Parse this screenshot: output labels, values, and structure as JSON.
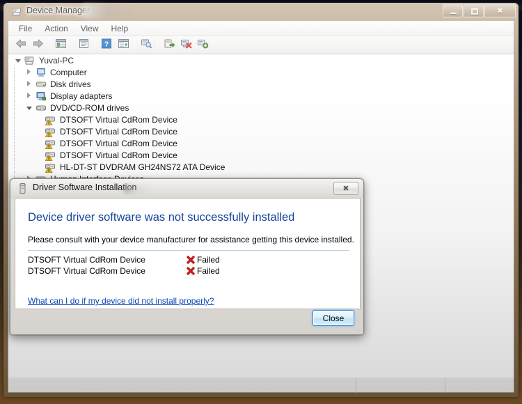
{
  "window": {
    "title": "Device Manager",
    "title_icon": "device-manager-icon",
    "controls": {
      "minimize": "Minimize",
      "maximize": "Maximize",
      "close": "Close"
    }
  },
  "menubar": {
    "items": [
      {
        "label": "File"
      },
      {
        "label": "Action"
      },
      {
        "label": "View"
      },
      {
        "label": "Help"
      }
    ]
  },
  "toolbar": {
    "buttons": [
      {
        "name": "back-button",
        "icon": "back-arrow-icon",
        "tooltip": "Back"
      },
      {
        "name": "forward-button",
        "icon": "forward-arrow-icon",
        "tooltip": "Forward"
      },
      {
        "name": "show-hide-console-tree-button",
        "icon": "console-tree-icon",
        "tooltip": "Show/Hide Console Tree"
      },
      {
        "name": "properties-button",
        "icon": "properties-icon",
        "tooltip": "Properties"
      },
      {
        "name": "help-button",
        "icon": "help-question-icon",
        "tooltip": "Help"
      },
      {
        "name": "view-button",
        "icon": "view-list-icon",
        "tooltip": "View"
      },
      {
        "name": "scan-hardware-changes-button",
        "icon": "scan-magnifier-icon",
        "tooltip": "Scan for hardware changes"
      },
      {
        "name": "update-driver-button",
        "icon": "update-driver-icon",
        "tooltip": "Update Driver Software"
      },
      {
        "name": "uninstall-device-button",
        "icon": "uninstall-device-icon",
        "tooltip": "Uninstall"
      },
      {
        "name": "disable-device-button",
        "icon": "disable-device-icon",
        "tooltip": "Disable"
      }
    ]
  },
  "tree": {
    "nodes": [
      {
        "label": "Yuval-PC",
        "indent": 0,
        "state": "expanded",
        "icon": "computer-root-icon",
        "warning": false
      },
      {
        "label": "Computer",
        "indent": 1,
        "state": "collapsed",
        "icon": "computer-icon",
        "warning": false
      },
      {
        "label": "Disk drives",
        "indent": 1,
        "state": "collapsed",
        "icon": "disk-drive-icon",
        "warning": false
      },
      {
        "label": "Display adapters",
        "indent": 1,
        "state": "collapsed",
        "icon": "display-adapter-icon",
        "warning": false
      },
      {
        "label": "DVD/CD-ROM drives",
        "indent": 1,
        "state": "expanded",
        "icon": "dvd-drive-icon",
        "warning": false
      },
      {
        "label": "DTSOFT Virtual CdRom Device",
        "indent": 2,
        "state": "leaf",
        "icon": "cdrom-device-icon",
        "warning": true
      },
      {
        "label": "DTSOFT Virtual CdRom Device",
        "indent": 2,
        "state": "leaf",
        "icon": "cdrom-device-icon",
        "warning": true
      },
      {
        "label": "DTSOFT Virtual CdRom Device",
        "indent": 2,
        "state": "leaf",
        "icon": "cdrom-device-icon",
        "warning": true
      },
      {
        "label": "DTSOFT Virtual CdRom Device",
        "indent": 2,
        "state": "leaf",
        "icon": "cdrom-device-icon",
        "warning": true
      },
      {
        "label": "HL-DT-ST DVDRAM GH24NS72 ATA Device",
        "indent": 2,
        "state": "leaf",
        "icon": "cdrom-device-icon",
        "warning": true
      },
      {
        "label": "Human Interface Devices",
        "indent": 1,
        "state": "collapsed",
        "icon": "hid-icon",
        "warning": false
      }
    ]
  },
  "statusbar": {
    "pane1": "",
    "pane2": "",
    "pane3": ""
  },
  "dialog": {
    "title": "Driver Software Installation",
    "title_icon": "driver-install-icon",
    "close_icon": "close-icon",
    "heading": "Device driver software was not successfully installed",
    "subtext": "Please consult with your device manufacturer for assistance getting this device installed.",
    "results": [
      {
        "device": "DTSOFT Virtual CdRom Device",
        "status": "Failed",
        "status_icon": "failed-x-icon"
      },
      {
        "device": "DTSOFT Virtual CdRom Device",
        "status": "Failed",
        "status_icon": "failed-x-icon"
      }
    ],
    "help_link": "What can I do if my device did not install properly?",
    "close_button": "Close"
  },
  "colors": {
    "heading_blue": "#15459b",
    "link_blue": "#0b46b8",
    "failed_red": "#c02020",
    "warning_yellow": "#f7c10a",
    "window_frame": "#9d8464"
  }
}
